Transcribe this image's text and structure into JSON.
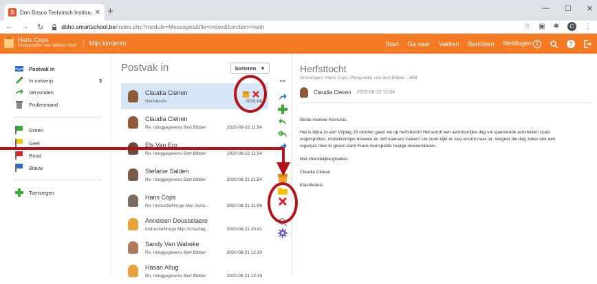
{
  "browser": {
    "tab_title": "Don Bosco Technisch Instituut - ...",
    "tab_close": "✕",
    "new_tab": "+",
    "window_controls": [
      "—",
      "☐",
      "✕"
    ],
    "nav_back": "←",
    "nav_forward": "→",
    "nav_reload": "↻",
    "url_host": "dbho.smartschool.be",
    "url_path": "/index.php?module=Messages&file=index&function=main",
    "profile_initial": "C"
  },
  "topbar": {
    "user_name": "Hans Cops",
    "user_role": "Pleegvader van Bibber Bert",
    "kids_link": "Mijn kinderen",
    "nav": [
      "Start",
      "Ga naar",
      "Vakken",
      "Berichten",
      "Meldingen"
    ],
    "notifications_count": "2",
    "accent": "#f47a24"
  },
  "sidebar": {
    "folders": [
      {
        "label": "Postvak in",
        "count": "",
        "icon": "inbox-icon"
      },
      {
        "label": "In ontwerp",
        "count": "3",
        "icon": "pencil-icon"
      },
      {
        "label": "Verzonden",
        "count": "",
        "icon": "sent-arrow-icon"
      },
      {
        "label": "Prullenmand",
        "count": "",
        "icon": "trash-icon"
      }
    ],
    "labels": [
      {
        "label": "Groen",
        "color": "#3aa935"
      },
      {
        "label": "Geel",
        "color": "#f5c400"
      },
      {
        "label": "Rood",
        "color": "#e0202a"
      },
      {
        "label": "Blauw",
        "color": "#2b6cd4"
      }
    ],
    "add_label": "Toevoegen"
  },
  "list": {
    "title": "Postvak in",
    "sort_label": "Sorteren",
    "messages": [
      {
        "from": "Claudia Cleiren",
        "subject": "Herfsttocht",
        "date": "2020-08-22 12:04",
        "date_visible": "2020-08",
        "avatar": "#8d5a3b"
      },
      {
        "from": "Claudia Cleiren",
        "subject": "Re: Inloggegevens Bert Bibber",
        "date": "2020-08-22 11:54",
        "avatar": "#8d5a3b"
      },
      {
        "from": "Els Van Erp",
        "subject": "Re: Inloggegevens Bert Bibber",
        "date": "2020-08-22 11:54",
        "avatar": "#6b4a3a"
      },
      {
        "from": "Stefanie Salden",
        "subject": "Re: Inloggegevens Bert Bibber",
        "date": "2020-08-21 21:54",
        "avatar": "#7a5a48"
      },
      {
        "from": "Hans Cops",
        "subject": "Re: Instructiefilmpje Mijn Scho...",
        "date": "2020-08-21 21:06",
        "avatar": "#7a6a60"
      },
      {
        "from": "Anneleen Dousselaere",
        "subject": "Instructiefilmpje Mijn Schoolag...",
        "date": "2020-08-21 20:41",
        "avatar": "#e8a33a"
      },
      {
        "from": "Sandy Van Wabeke",
        "subject": "Re: Inloggegevens Bert Bibber",
        "date": "2020-08-21 12:30",
        "avatar": "#b07a5a"
      },
      {
        "from": "Hasan Altug",
        "subject": "Re: Inloggegevens Bert Bibber",
        "date": "2020-08-21 12:15",
        "avatar": "#e8a33a"
      }
    ]
  },
  "message": {
    "subject": "Herfsttocht",
    "recipients": "Ontvangers:  Hans Cops, Pleegvader van Bert Bibber - 3BB",
    "sender": "Claudia Cleiren",
    "date": "2020-08-22 12:04",
    "greeting": "Beste meneer Kumulus,",
    "body_line1": "Het is bijna zo ver! Vrijdag 16 oktober gaan we op herfsttocht! Het wordt een avontuurlijke dag vol spannende activiteiten zoals",
    "body_line2": "vogelspotten, modeltreintjes bouwen en zelf kaarsen maken! Uw zoon kijkt er vast enorm naar uit. Vergeet die dag zeker niet een",
    "body_line3": "regenjas mee te geven want Frank voorspelde hevige onweersbuien.",
    "closing": "Met vriendelijke groeten,",
    "signature_name": "Claudia Cleiren",
    "signature_role": "Klastitularis"
  },
  "colors": {
    "annotation": "#b3131b",
    "selected_row": "#d6e8f7"
  }
}
